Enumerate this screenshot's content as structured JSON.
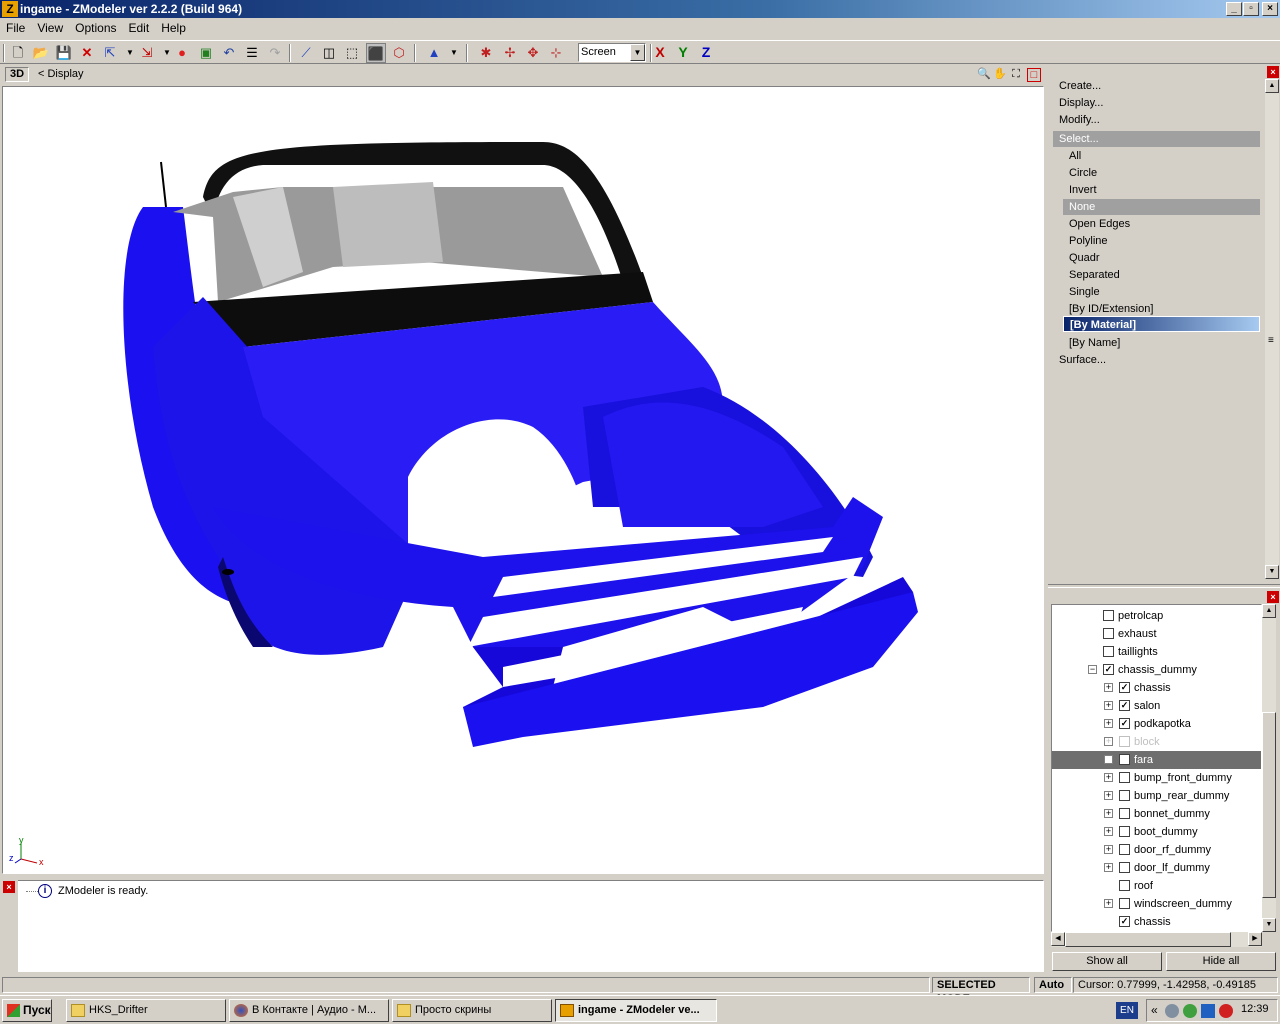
{
  "window": {
    "title": "ingame - ZModeler ver 2.2.2 (Build 964)",
    "icon": "Z",
    "minimize": "_",
    "maximize": "▫",
    "close": "×"
  },
  "menu": [
    "File",
    "View",
    "Options",
    "Edit",
    "Help"
  ],
  "toolbar": {
    "view_combo": "Screen",
    "axis_x": "X",
    "axis_y": "Y",
    "axis_z": "Z"
  },
  "viewport": {
    "mode_button": "3D",
    "crumb": "<  Display",
    "axis_x": "x",
    "axis_y": "y",
    "axis_z": "z",
    "model_color": "#1a10f0"
  },
  "log": {
    "message": "ZModeler is ready."
  },
  "right_panel": {
    "items": {
      "create": "Create...",
      "display": "Display...",
      "modify": "Modify...",
      "select": "Select...",
      "surface": "Surface..."
    },
    "select_sub": [
      "All",
      "Circle",
      "Invert",
      "None",
      "Open Edges",
      "Polyline",
      "Quadr",
      "Separated",
      "Single",
      "[By ID/Extension]",
      "[By Material]",
      "[By Name]"
    ],
    "selected_index": 3,
    "highlighted_index": 10
  },
  "tree": {
    "rows": [
      {
        "label": "petrolcap",
        "checked": false
      },
      {
        "label": "exhaust",
        "checked": false
      },
      {
        "label": "taillights",
        "checked": false
      },
      {
        "label": "chassis_dummy",
        "checked": true
      },
      {
        "label": "chassis",
        "checked": true
      },
      {
        "label": "salon",
        "checked": true
      },
      {
        "label": "podkapotka",
        "checked": true
      },
      {
        "label": "block",
        "checked": false
      },
      {
        "label": "fara",
        "checked": false
      },
      {
        "label": "bump_front_dummy",
        "checked": false
      },
      {
        "label": "bump_rear_dummy",
        "checked": false
      },
      {
        "label": "bonnet_dummy",
        "checked": false
      },
      {
        "label": "boot_dummy",
        "checked": false
      },
      {
        "label": "door_rf_dummy",
        "checked": false
      },
      {
        "label": "door_lf_dummy",
        "checked": false
      },
      {
        "label": "roof",
        "checked": false
      },
      {
        "label": "windscreen_dummy",
        "checked": false
      },
      {
        "label": "chassis",
        "checked": true
      }
    ]
  },
  "buttons": {
    "show_all": "Show all",
    "hide_all": "Hide all"
  },
  "status": {
    "mode": "SELECTED MODE",
    "auto": "Auto",
    "cursor": "Cursor: 0.77999, -1.42958, -0.49185"
  },
  "taskbar": {
    "start": "Пуск",
    "tasks": [
      "HKS_Drifter",
      "В Контакте | Аудио - М...",
      "Просто скрины",
      "ingame - ZModeler ve..."
    ],
    "lang": "EN",
    "clock": "12:39"
  }
}
